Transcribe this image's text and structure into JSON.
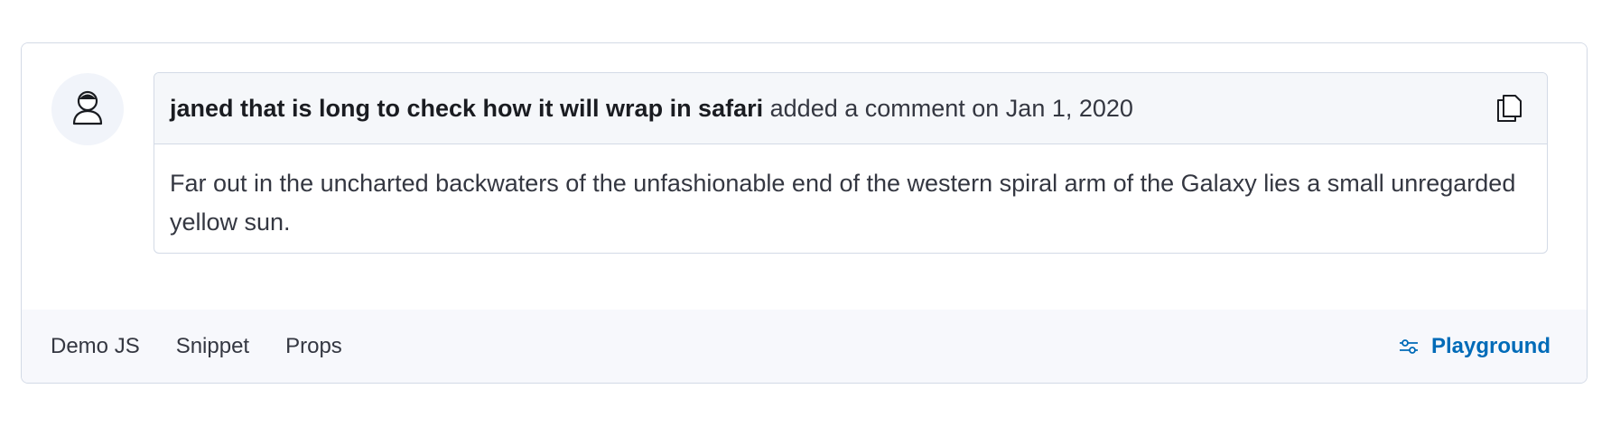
{
  "comment": {
    "author": "janed that is long to check how it will wrap in safari",
    "action": "added a comment on Jan 1, 2020",
    "body": "Far out in the uncharted backwaters of the unfashionable end of the western spiral arm of the Galaxy lies a small unregarded yellow sun.",
    "avatar_icon": "user-icon",
    "copy_icon": "copy-icon"
  },
  "footer": {
    "tabs": [
      "Demo JS",
      "Snippet",
      "Props"
    ],
    "playground_label": "Playground",
    "playground_icon": "controls-icon"
  },
  "colors": {
    "accent": "#006bb8",
    "border": "#d3dae6",
    "header_bg": "#f5f7fa",
    "footer_bg": "#f7f8fc"
  }
}
